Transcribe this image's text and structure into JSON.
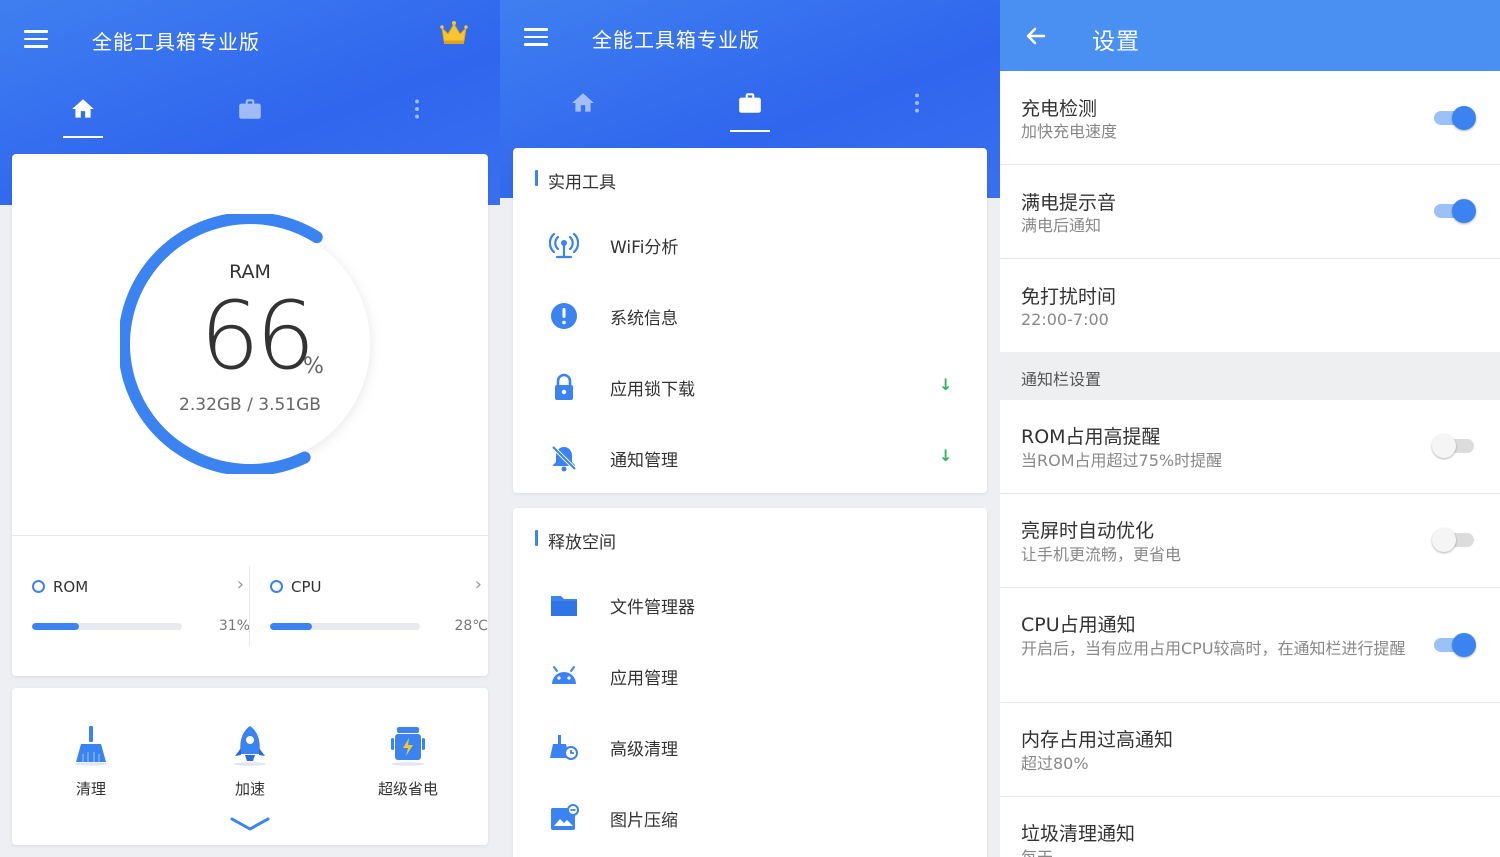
{
  "colors": {
    "primary": "#3b83f0",
    "header": "#2f66ee",
    "settings_bar": "#4a8ff2",
    "download": "#2db85c"
  },
  "app": {
    "title": "全能工具箱专业版"
  },
  "tabs": {
    "home_icon": "home-icon",
    "tools_icon": "briefcase-icon",
    "more_icon": "more-vert-icon"
  },
  "home": {
    "ram": {
      "label": "RAM",
      "value": "66",
      "unit": "%",
      "detail": "2.32GB / 3.51GB",
      "fraction": 0.66
    },
    "rom": {
      "label": "ROM",
      "value": "31%",
      "fraction": 0.31
    },
    "cpu": {
      "label": "CPU",
      "value": "28℃",
      "fraction": 0.28
    },
    "actions": [
      {
        "label": "清理",
        "icon": "broom-icon"
      },
      {
        "label": "加速",
        "icon": "rocket-icon"
      },
      {
        "label": "超级省电",
        "icon": "android-battery-icon"
      }
    ]
  },
  "tools": {
    "practical": {
      "header": "实用工具",
      "items": [
        {
          "label": "WiFi分析",
          "icon": "wifi-tower-icon"
        },
        {
          "label": "系统信息",
          "icon": "info-alert-icon"
        },
        {
          "label": "应用锁下载",
          "icon": "lock-icon",
          "download": "↓"
        },
        {
          "label": "通知管理",
          "icon": "bell-off-icon",
          "download": "↓"
        }
      ]
    },
    "space": {
      "header": "释放空间",
      "items": [
        {
          "label": "文件管理器",
          "icon": "folder-icon"
        },
        {
          "label": "应用管理",
          "icon": "android-icon"
        },
        {
          "label": "高级清理",
          "icon": "advanced-clean-icon"
        },
        {
          "label": "图片压缩",
          "icon": "image-compress-icon"
        }
      ]
    }
  },
  "settings": {
    "title": "设置",
    "rows": [
      {
        "title": "充电检测",
        "sub": "加快充电速度",
        "toggle": true
      },
      {
        "title": "满电提示音",
        "sub": "满电后通知",
        "toggle": true
      },
      {
        "title": "免打扰时间",
        "sub": "22:00-7:00"
      }
    ],
    "section": "通知栏设置",
    "notify_rows": [
      {
        "title": "ROM占用高提醒",
        "sub": "当ROM占用超过75%时提醒",
        "toggle": false
      },
      {
        "title": "亮屏时自动优化",
        "sub": "让手机更流畅，更省电",
        "toggle": false
      },
      {
        "title": "CPU占用通知",
        "sub": "开启后，当有应用占用CPU较高时，在通知栏进行提醒",
        "toggle": true
      },
      {
        "title": "内存占用过高通知",
        "sub": "超过80%"
      },
      {
        "title": "垃圾清理通知",
        "sub": "每天"
      }
    ]
  }
}
